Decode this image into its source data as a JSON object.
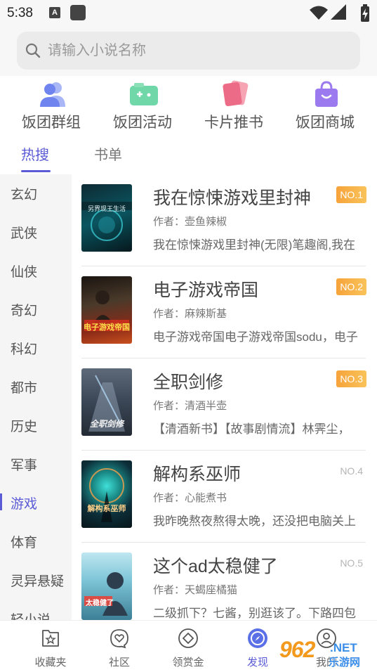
{
  "status_bar": {
    "time": "5:38",
    "notification_badge": "A",
    "icons": [
      "wifi-icon",
      "signal-icon",
      "battery-charging-icon"
    ]
  },
  "search": {
    "placeholder": "请输入小说名称",
    "value": ""
  },
  "quick_actions": [
    {
      "label": "饭团群组",
      "icon": "group-users-icon"
    },
    {
      "label": "饭团活动",
      "icon": "game-activity-icon"
    },
    {
      "label": "卡片推书",
      "icon": "cards-icon"
    },
    {
      "label": "饭团商城",
      "icon": "shopping-bag-icon"
    }
  ],
  "tabs": [
    {
      "label": "热搜",
      "active": true
    },
    {
      "label": "书单",
      "active": false
    }
  ],
  "categories": [
    {
      "label": "玄幻",
      "active": false
    },
    {
      "label": "武侠",
      "active": false
    },
    {
      "label": "仙侠",
      "active": false
    },
    {
      "label": "奇幻",
      "active": false
    },
    {
      "label": "科幻",
      "active": false
    },
    {
      "label": "都市",
      "active": false
    },
    {
      "label": "历史",
      "active": false
    },
    {
      "label": "军事",
      "active": false
    },
    {
      "label": "游戏",
      "active": true
    },
    {
      "label": "体育",
      "active": false
    },
    {
      "label": "灵异悬疑",
      "active": false
    },
    {
      "label": "轻小说",
      "active": false
    }
  ],
  "books": [
    {
      "title": "我在惊悚游戏里封神",
      "author": "作者：壶鱼辣椒",
      "desc": "我在惊悚游戏里封神(无限)笔趣阁,我在",
      "rank": "NO.1",
      "highlight": true,
      "cover_text": "另界现王生活"
    },
    {
      "title": "电子游戏帝国",
      "author": "作者：麻辣斯基",
      "desc": "电子游戏帝国电子游戏帝国sodu，电子",
      "rank": "NO.2",
      "highlight": true,
      "cover_text": "电子游戏帝国"
    },
    {
      "title": "全职剑修",
      "author": "作者：清酒半壶",
      "desc": "【清酒新书】【故事剧情流】林霁尘，",
      "rank": "NO.3",
      "highlight": true,
      "cover_text": "全职剑修"
    },
    {
      "title": "解构系巫师",
      "author": "作者：心能煮书",
      "desc": "我昨晚熬夜熬得太晚，还没把电脑关上",
      "rank": "NO.4",
      "highlight": false,
      "cover_text": "解构系巫师"
    },
    {
      "title": "这个ad太稳健了",
      "author": "作者：天蝎座橘猫",
      "desc": "二级抓下？七酱，别逛该了。下路四包",
      "rank": "NO.5",
      "highlight": false,
      "cover_text": "太稳健了"
    }
  ],
  "bottom_nav": [
    {
      "label": "收藏夹",
      "icon": "bookmark-star-icon",
      "active": false
    },
    {
      "label": "社区",
      "icon": "heart-chat-icon",
      "active": false
    },
    {
      "label": "领赏金",
      "icon": "diamond-icon",
      "active": false
    },
    {
      "label": "发现",
      "icon": "compass-icon",
      "active": true
    },
    {
      "label": "我的",
      "icon": "profile-icon",
      "active": false
    }
  ],
  "watermark": {
    "number": "962",
    "suffix": ".NET",
    "site": "乐游网"
  },
  "colors": {
    "accent": "#5b5bd6",
    "rank_badge": "#f6a33a",
    "sidebar_bg": "#f5f5f5"
  }
}
